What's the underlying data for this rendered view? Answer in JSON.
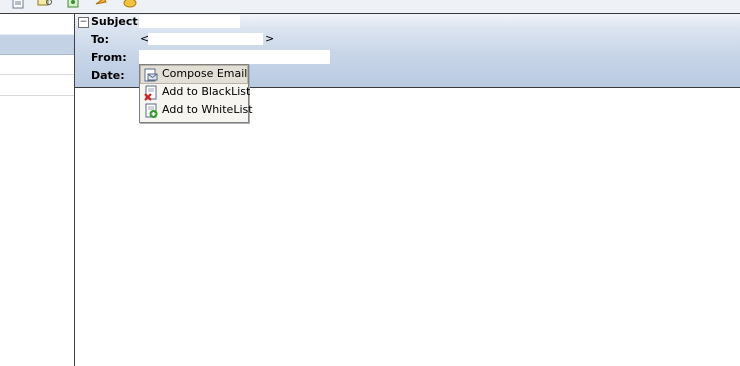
{
  "toolbar": {
    "icons": [
      "document-icon",
      "search-mail-icon",
      "refresh-icon",
      "flag-icon",
      "tag-icon"
    ]
  },
  "header": {
    "collapse_symbol": "−",
    "subject_label": "Subject:",
    "to_label": "To:",
    "to_prefix": "<",
    "to_suffix": ">",
    "from_label": "From:",
    "date_label": "Date:"
  },
  "context_menu": {
    "items": [
      {
        "label": "Compose Email",
        "icon": "compose-email-icon"
      },
      {
        "label": "Add to BlackList",
        "icon": "blacklist-icon"
      },
      {
        "label": "Add to WhiteList",
        "icon": "whitelist-icon"
      }
    ]
  },
  "colors": {
    "header_gradient_top": "#f2f5fa",
    "header_gradient_bottom": "#b9cbe2",
    "left_pane_header": "#c4d2e6",
    "menu_background": "#f6f5f0",
    "menu_highlight": "#e2e0d6"
  }
}
